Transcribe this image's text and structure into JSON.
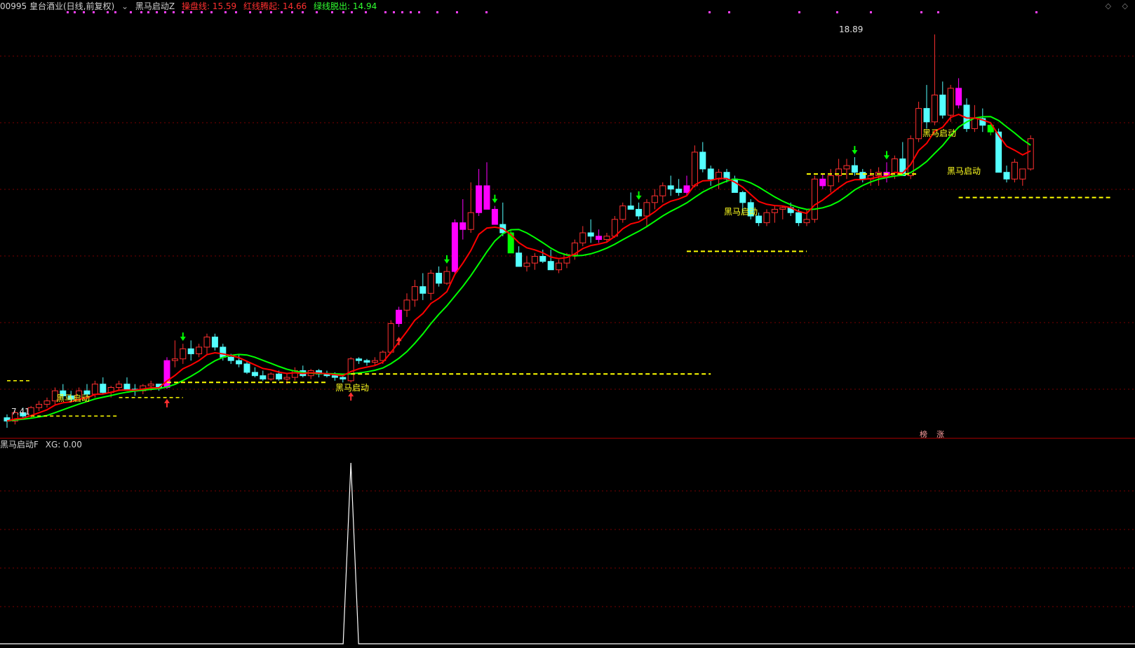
{
  "header": {
    "stock": "00995 皇台酒业(日线,前复权)",
    "indicator": "黑马启动Z",
    "line1_label": "操盘线: 15.59",
    "line2_label": "红线腾起: 14.66",
    "line3_label": "绿线脱出: 14.94"
  },
  "sub_header": {
    "indicator": "黑马启动F",
    "value_label": "XG: 0.00"
  },
  "window_controls": "◇ ◇",
  "annotations": {
    "signal_text": "黑马启动",
    "high_label": "18.89",
    "low_label": "7.41",
    "badge1": "榜",
    "badge2": "涨"
  },
  "colors": {
    "background": "#000000",
    "grid": "#7a0000",
    "up_candle": "#ff3030",
    "down_candle": "#54ffff",
    "signal_candle": "#ff00ff",
    "green_candle": "#00ff00",
    "red_line": "#ff0000",
    "green_line": "#00ff00",
    "support_line": "#ffff00",
    "dot_marker": "#ff40ff",
    "sub_line": "#ffffff"
  },
  "chart_data": [
    {
      "type": "candlestick",
      "title": "",
      "y_range": [
        7.2,
        19.3
      ],
      "count": 142,
      "ohlc": [
        [
          7.5,
          7.6,
          7.2,
          7.4
        ],
        [
          7.4,
          7.7,
          7.3,
          7.65
        ],
        [
          7.65,
          7.8,
          7.5,
          7.55
        ],
        [
          7.55,
          7.85,
          7.5,
          7.8
        ],
        [
          7.8,
          8.0,
          7.7,
          7.9
        ],
        [
          7.9,
          8.1,
          7.8,
          8.0
        ],
        [
          8.0,
          8.4,
          7.9,
          8.3
        ],
        [
          8.3,
          8.5,
          8.05,
          8.15
        ],
        [
          8.15,
          8.3,
          7.95,
          8.05
        ],
        [
          8.05,
          8.4,
          8.0,
          8.3
        ],
        [
          8.3,
          8.5,
          8.1,
          8.2
        ],
        [
          8.2,
          8.6,
          8.1,
          8.5
        ],
        [
          8.5,
          8.7,
          8.2,
          8.25
        ],
        [
          8.25,
          8.45,
          8.1,
          8.4
        ],
        [
          8.4,
          8.6,
          8.3,
          8.5
        ],
        [
          8.5,
          8.7,
          8.3,
          8.35
        ],
        [
          8.35,
          8.5,
          8.15,
          8.3
        ],
        [
          8.3,
          8.5,
          8.2,
          8.45
        ],
        [
          8.45,
          8.6,
          8.3,
          8.5
        ],
        [
          8.5,
          8.45,
          8.3,
          8.4
        ],
        [
          8.4,
          9.3,
          8.35,
          9.2
        ],
        [
          9.2,
          9.8,
          9.0,
          9.25
        ],
        [
          9.25,
          9.7,
          9.1,
          9.55
        ],
        [
          9.55,
          9.8,
          9.2,
          9.4
        ],
        [
          9.4,
          9.7,
          9.3,
          9.6
        ],
        [
          9.6,
          10.0,
          9.4,
          9.9
        ],
        [
          9.9,
          10.0,
          9.5,
          9.6
        ],
        [
          9.6,
          9.7,
          9.2,
          9.3
        ],
        [
          9.3,
          9.4,
          9.1,
          9.2
        ],
        [
          9.2,
          9.4,
          9.0,
          9.1
        ],
        [
          9.1,
          9.2,
          8.8,
          8.85
        ],
        [
          8.85,
          9.0,
          8.7,
          8.75
        ],
        [
          8.75,
          8.9,
          8.6,
          8.65
        ],
        [
          8.65,
          8.85,
          8.6,
          8.8
        ],
        [
          8.8,
          8.9,
          8.6,
          8.65
        ],
        [
          8.65,
          8.8,
          8.5,
          8.7
        ],
        [
          8.7,
          9.0,
          8.6,
          8.9
        ],
        [
          8.9,
          9.05,
          8.7,
          8.75
        ],
        [
          8.75,
          8.95,
          8.65,
          8.9
        ],
        [
          8.9,
          8.95,
          8.7,
          8.8
        ],
        [
          8.8,
          8.9,
          8.7,
          8.75
        ],
        [
          8.75,
          8.85,
          8.6,
          8.7
        ],
        [
          8.7,
          8.8,
          8.55,
          8.65
        ],
        [
          8.6,
          9.3,
          8.55,
          9.25
        ],
        [
          9.25,
          9.3,
          9.1,
          9.2
        ],
        [
          9.2,
          9.25,
          9.05,
          9.15
        ],
        [
          9.15,
          9.3,
          9.05,
          9.2
        ],
        [
          9.2,
          9.5,
          9.1,
          9.45
        ],
        [
          9.45,
          10.4,
          9.4,
          10.3
        ],
        [
          10.3,
          10.8,
          10.2,
          10.7
        ],
        [
          10.7,
          11.2,
          10.5,
          11.0
        ],
        [
          11.0,
          11.6,
          10.8,
          11.4
        ],
        [
          11.4,
          11.8,
          11.0,
          11.2
        ],
        [
          11.2,
          11.9,
          11.0,
          11.8
        ],
        [
          11.8,
          12.0,
          11.4,
          11.5
        ],
        [
          11.5,
          12.0,
          11.45,
          11.85
        ],
        [
          11.85,
          13.4,
          11.8,
          13.3
        ],
        [
          13.3,
          14.0,
          12.8,
          13.1
        ],
        [
          13.1,
          14.5,
          13.0,
          13.6
        ],
        [
          13.6,
          14.9,
          13.5,
          14.4
        ],
        [
          14.4,
          15.1,
          13.9,
          13.7
        ],
        [
          13.7,
          13.8,
          13.3,
          13.25
        ],
        [
          13.25,
          13.9,
          12.9,
          13.0
        ],
        [
          13.0,
          13.1,
          12.6,
          12.4
        ],
        [
          12.4,
          12.6,
          12.3,
          12.0
        ],
        [
          12.0,
          12.3,
          11.85,
          12.1
        ],
        [
          12.1,
          12.4,
          11.9,
          12.3
        ],
        [
          12.3,
          12.5,
          12.1,
          12.15
        ],
        [
          12.15,
          12.5,
          11.9,
          11.9
        ],
        [
          11.9,
          12.2,
          11.8,
          12.1
        ],
        [
          12.1,
          12.4,
          11.95,
          12.35
        ],
        [
          12.35,
          12.8,
          12.2,
          12.7
        ],
        [
          12.7,
          13.2,
          12.6,
          13.0
        ],
        [
          13.0,
          13.4,
          12.7,
          12.9
        ],
        [
          12.9,
          13.1,
          12.7,
          12.8
        ],
        [
          12.8,
          13.0,
          12.7,
          12.9
        ],
        [
          12.9,
          13.5,
          12.85,
          13.4
        ],
        [
          13.4,
          13.9,
          13.3,
          13.8
        ],
        [
          13.8,
          14.2,
          13.7,
          13.7
        ],
        [
          13.7,
          13.9,
          13.4,
          13.5
        ],
        [
          13.5,
          14.0,
          13.2,
          13.9
        ],
        [
          13.9,
          14.3,
          13.7,
          14.1
        ],
        [
          14.1,
          14.5,
          13.9,
          14.4
        ],
        [
          14.4,
          14.7,
          14.1,
          14.3
        ],
        [
          14.3,
          14.6,
          14.1,
          14.2
        ],
        [
          14.2,
          14.7,
          14.1,
          14.4
        ],
        [
          14.4,
          15.6,
          14.35,
          15.4
        ],
        [
          15.4,
          15.7,
          14.8,
          14.9
        ],
        [
          14.9,
          15.0,
          14.4,
          14.6
        ],
        [
          14.6,
          14.9,
          14.3,
          14.8
        ],
        [
          14.8,
          14.9,
          14.5,
          14.6
        ],
        [
          14.6,
          14.7,
          14.3,
          14.2
        ],
        [
          14.2,
          14.25,
          13.6,
          13.9
        ],
        [
          13.9,
          14.0,
          13.4,
          13.5
        ],
        [
          13.5,
          13.6,
          13.2,
          13.3
        ],
        [
          13.3,
          13.7,
          13.2,
          13.6
        ],
        [
          13.6,
          13.8,
          13.3,
          13.7
        ],
        [
          13.7,
          13.8,
          13.4,
          13.75
        ],
        [
          13.75,
          13.9,
          13.5,
          13.6
        ],
        [
          13.6,
          13.7,
          13.2,
          13.3
        ],
        [
          13.3,
          13.7,
          13.2,
          13.4
        ],
        [
          13.4,
          14.7,
          13.3,
          14.6
        ],
        [
          14.6,
          14.75,
          14.3,
          14.4
        ],
        [
          14.4,
          14.9,
          14.2,
          14.7
        ],
        [
          14.7,
          15.2,
          14.5,
          14.9
        ],
        [
          14.9,
          15.2,
          14.6,
          15.0
        ],
        [
          15.0,
          15.25,
          14.7,
          14.8
        ],
        [
          14.8,
          14.9,
          14.5,
          14.6
        ],
        [
          14.6,
          14.9,
          14.4,
          14.7
        ],
        [
          14.7,
          14.95,
          14.4,
          14.8
        ],
        [
          14.8,
          15.1,
          14.5,
          14.7
        ],
        [
          14.7,
          15.3,
          14.6,
          15.2
        ],
        [
          15.2,
          15.7,
          15.0,
          14.7
        ],
        [
          14.7,
          15.9,
          14.6,
          15.8
        ],
        [
          15.8,
          16.9,
          15.7,
          16.7
        ],
        [
          16.7,
          17.4,
          16.1,
          16.3
        ],
        [
          16.3,
          18.9,
          16.2,
          17.1
        ],
        [
          17.1,
          17.5,
          16.4,
          16.5
        ],
        [
          16.5,
          17.4,
          16.3,
          17.3
        ],
        [
          17.3,
          17.6,
          16.7,
          16.8
        ],
        [
          16.8,
          17.0,
          16.0,
          16.1
        ],
        [
          16.1,
          16.8,
          16.0,
          16.4
        ],
        [
          16.4,
          16.7,
          16.0,
          16.2
        ],
        [
          16.2,
          16.3,
          15.9,
          16.0
        ],
        [
          16.0,
          16.1,
          14.8,
          14.8
        ],
        [
          14.8,
          15.0,
          14.5,
          14.6
        ],
        [
          14.6,
          15.2,
          14.5,
          15.1
        ],
        [
          14.6,
          14.9,
          14.4,
          14.9
        ],
        [
          14.9,
          15.9,
          14.85,
          15.8
        ]
      ],
      "signal_bars": [
        20,
        49,
        56,
        57,
        59,
        60,
        61,
        74,
        85,
        102,
        110,
        119
      ],
      "green_bars": [
        63,
        123
      ]
    },
    {
      "type": "line",
      "title": "",
      "y_range": [
        0,
        1
      ],
      "count": 142,
      "spike_at": 43,
      "values_note_label": "XG"
    }
  ]
}
